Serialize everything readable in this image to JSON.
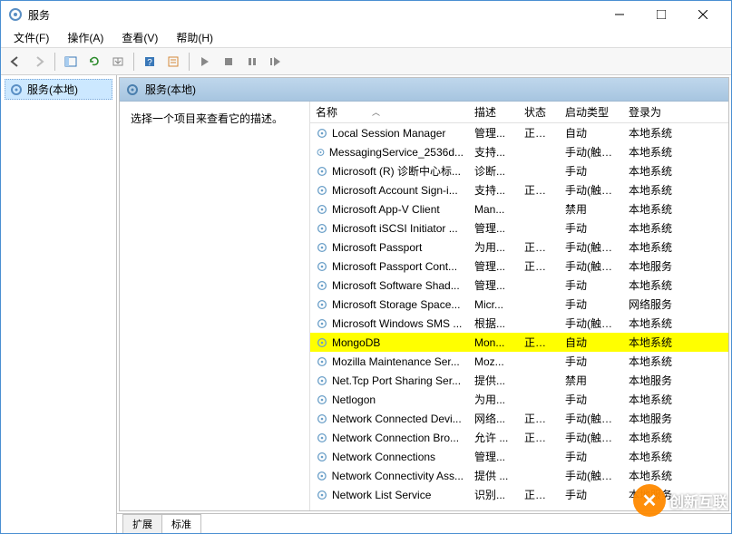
{
  "window": {
    "title": "服务",
    "menubar": [
      "文件(F)",
      "操作(A)",
      "查看(V)",
      "帮助(H)"
    ]
  },
  "tree": {
    "root": "服务(本地)"
  },
  "content": {
    "header": "服务(本地)",
    "description_hint": "选择一个项目来查看它的描述。",
    "columns": {
      "name": "名称",
      "desc": "描述",
      "status": "状态",
      "startup": "启动类型",
      "logon": "登录为"
    },
    "tabs": {
      "extended": "扩展",
      "standard": "标准"
    }
  },
  "services": [
    {
      "name": "Local Session Manager",
      "desc": "管理...",
      "status": "正在...",
      "startup": "自动",
      "logon": "本地系统",
      "hl": false
    },
    {
      "name": "MessagingService_2536d...",
      "desc": "支持...",
      "status": "",
      "startup": "手动(触发...",
      "logon": "本地系统",
      "hl": false
    },
    {
      "name": "Microsoft (R) 诊断中心标...",
      "desc": "诊断...",
      "status": "",
      "startup": "手动",
      "logon": "本地系统",
      "hl": false
    },
    {
      "name": "Microsoft Account Sign-i...",
      "desc": "支持...",
      "status": "正在...",
      "startup": "手动(触发...",
      "logon": "本地系统",
      "hl": false
    },
    {
      "name": "Microsoft App-V Client",
      "desc": "Man...",
      "status": "",
      "startup": "禁用",
      "logon": "本地系统",
      "hl": false
    },
    {
      "name": "Microsoft iSCSI Initiator ...",
      "desc": "管理...",
      "status": "",
      "startup": "手动",
      "logon": "本地系统",
      "hl": false
    },
    {
      "name": "Microsoft Passport",
      "desc": "为用...",
      "status": "正在...",
      "startup": "手动(触发...",
      "logon": "本地系统",
      "hl": false
    },
    {
      "name": "Microsoft Passport Cont...",
      "desc": "管理...",
      "status": "正在...",
      "startup": "手动(触发...",
      "logon": "本地服务",
      "hl": false
    },
    {
      "name": "Microsoft Software Shad...",
      "desc": "管理...",
      "status": "",
      "startup": "手动",
      "logon": "本地系统",
      "hl": false
    },
    {
      "name": "Microsoft Storage Space...",
      "desc": "Micr...",
      "status": "",
      "startup": "手动",
      "logon": "网络服务",
      "hl": false
    },
    {
      "name": "Microsoft Windows SMS ...",
      "desc": "根据...",
      "status": "",
      "startup": "手动(触发...",
      "logon": "本地系统",
      "hl": false
    },
    {
      "name": "MongoDB",
      "desc": "Mon...",
      "status": "正在...",
      "startup": "自动",
      "logon": "本地系统",
      "hl": true
    },
    {
      "name": "Mozilla Maintenance Ser...",
      "desc": "Moz...",
      "status": "",
      "startup": "手动",
      "logon": "本地系统",
      "hl": false
    },
    {
      "name": "Net.Tcp Port Sharing Ser...",
      "desc": "提供...",
      "status": "",
      "startup": "禁用",
      "logon": "本地服务",
      "hl": false
    },
    {
      "name": "Netlogon",
      "desc": "为用...",
      "status": "",
      "startup": "手动",
      "logon": "本地系统",
      "hl": false
    },
    {
      "name": "Network Connected Devi...",
      "desc": "网络...",
      "status": "正在...",
      "startup": "手动(触发...",
      "logon": "本地服务",
      "hl": false
    },
    {
      "name": "Network Connection Bro...",
      "desc": "允许 ...",
      "status": "正在...",
      "startup": "手动(触发...",
      "logon": "本地系统",
      "hl": false
    },
    {
      "name": "Network Connections",
      "desc": "管理...",
      "status": "",
      "startup": "手动",
      "logon": "本地系统",
      "hl": false
    },
    {
      "name": "Network Connectivity Ass...",
      "desc": "提供 ...",
      "status": "",
      "startup": "手动(触发...",
      "logon": "本地系统",
      "hl": false
    },
    {
      "name": "Network List Service",
      "desc": "识别...",
      "status": "正在...",
      "startup": "手动",
      "logon": "本地服务",
      "hl": false
    }
  ],
  "watermark": "创新互联"
}
